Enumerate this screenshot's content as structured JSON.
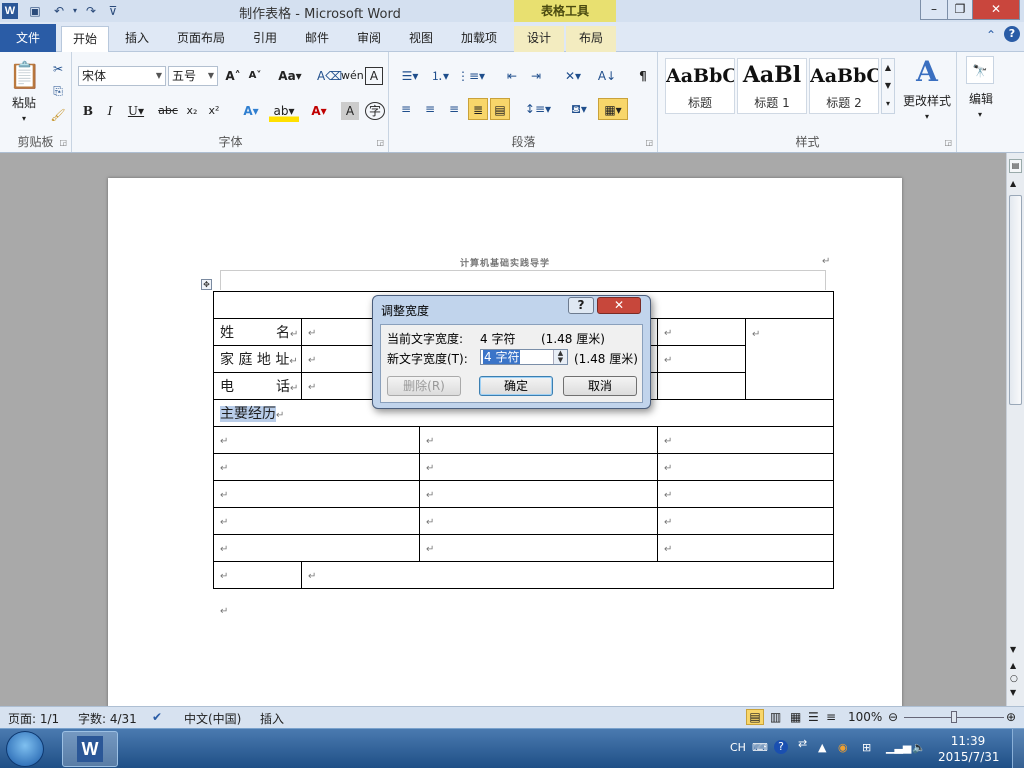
{
  "window": {
    "title": "制作表格 - Microsoft Word",
    "context_group": "表格工具",
    "app_letter": "W"
  },
  "tabs": [
    "文件",
    "开始",
    "插入",
    "页面布局",
    "引用",
    "邮件",
    "审阅",
    "视图",
    "加载项",
    "设计",
    "布局"
  ],
  "ribbon": {
    "clipboard": {
      "label": "剪贴板",
      "paste": "粘贴"
    },
    "font": {
      "label": "字体",
      "font_name": "宋体",
      "font_size": "五号"
    },
    "paragraph": {
      "label": "段落"
    },
    "styles": {
      "label": "样式",
      "items": [
        {
          "sample": "AaBbC",
          "name": "标题"
        },
        {
          "sample": "AaBl",
          "name": "标题 1"
        },
        {
          "sample": "AaBbC",
          "name": "标题 2"
        }
      ],
      "change_styles": "更改样式"
    },
    "editing": {
      "label": "编辑"
    }
  },
  "document": {
    "header": "计算机基础实践导学",
    "rows": {
      "name": "姓　　　名",
      "address": "家 庭 地 址",
      "phone": "电　　　话",
      "experience": "主要经历"
    },
    "para_mark": "↵"
  },
  "dialog": {
    "title": "调整宽度",
    "current_label": "当前文字宽度:",
    "current_value": "4 字符",
    "current_cm": "(1.48 厘米)",
    "new_label": "新文字宽度(T):",
    "new_value": "4 字符",
    "new_cm": "(1.48 厘米)",
    "delete": "删除(R)",
    "ok": "确定",
    "cancel": "取消"
  },
  "statusbar": {
    "page": "页面: 1/1",
    "words": "字数: 4/31",
    "language": "中文(中国)",
    "mode": "插入",
    "zoom": "100%"
  },
  "taskbar": {
    "ime": "CH",
    "time": "11:39",
    "date": "2015/7/31"
  },
  "colors": {
    "file_tab": "#2a5ca6",
    "context": "#e8e070",
    "selection": "#b9cde9"
  }
}
